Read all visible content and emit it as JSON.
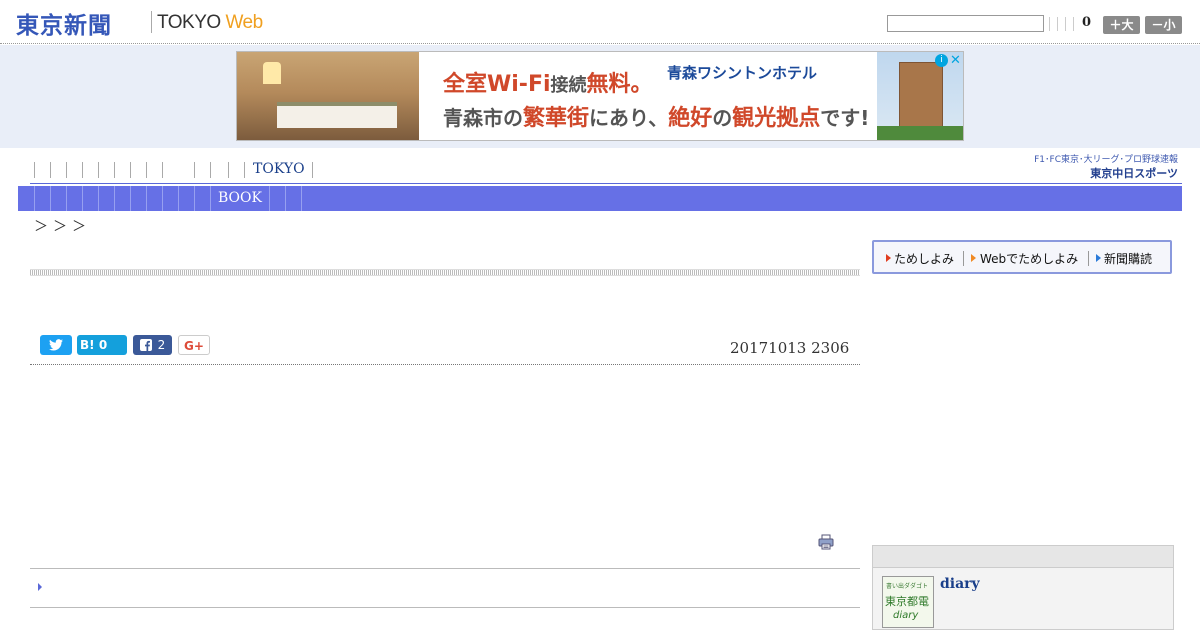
{
  "header": {
    "logo_jp": "東京新聞",
    "logo_en_prefix": "TOKYO ",
    "logo_en_suffix": "Web",
    "search_placeholder": "",
    "count": "0",
    "font_larger_label": "＋大",
    "font_smaller_label": "－小"
  },
  "ad": {
    "headline_red": "全室Wi-Fi",
    "headline_mid": "接続",
    "headline_end": "無料。",
    "brand": "青森ワシントンホテル",
    "line2_part1": "青森市の",
    "line2_red1": "繁華街",
    "line2_part2": "にあり、",
    "line2_red2": "絶好",
    "line2_part3": "の",
    "line2_red3": "観光拠点",
    "line2_part4": "です!",
    "info_icon": "i",
    "close_icon": "✕"
  },
  "nav_primary": {
    "tokyo_label": "TOKYO"
  },
  "chunichi_banner": {
    "line1": "F1･FC東京･大リーグ･プロ野球速報",
    "line2": "東京中日スポーツ"
  },
  "nav_secondary": {
    "book_label": "BOOK"
  },
  "breadcrumb": "＞＞＞",
  "share": {
    "twitter_icon": "twitter-bird-icon",
    "hatena_label": "B!",
    "hatena_count": "0",
    "facebook_count": "2",
    "gplus_label": "G+"
  },
  "article": {
    "date": "20171013 2306"
  },
  "trial_box": {
    "item1": "ためしよみ",
    "item2": "Webでためしよみ",
    "item3": "新聞購読"
  },
  "side_panel": {
    "thumb_line1": "書い出ダダゴト",
    "thumb_line2": "東京都電",
    "thumb_line3": "diary",
    "title": "diary"
  }
}
